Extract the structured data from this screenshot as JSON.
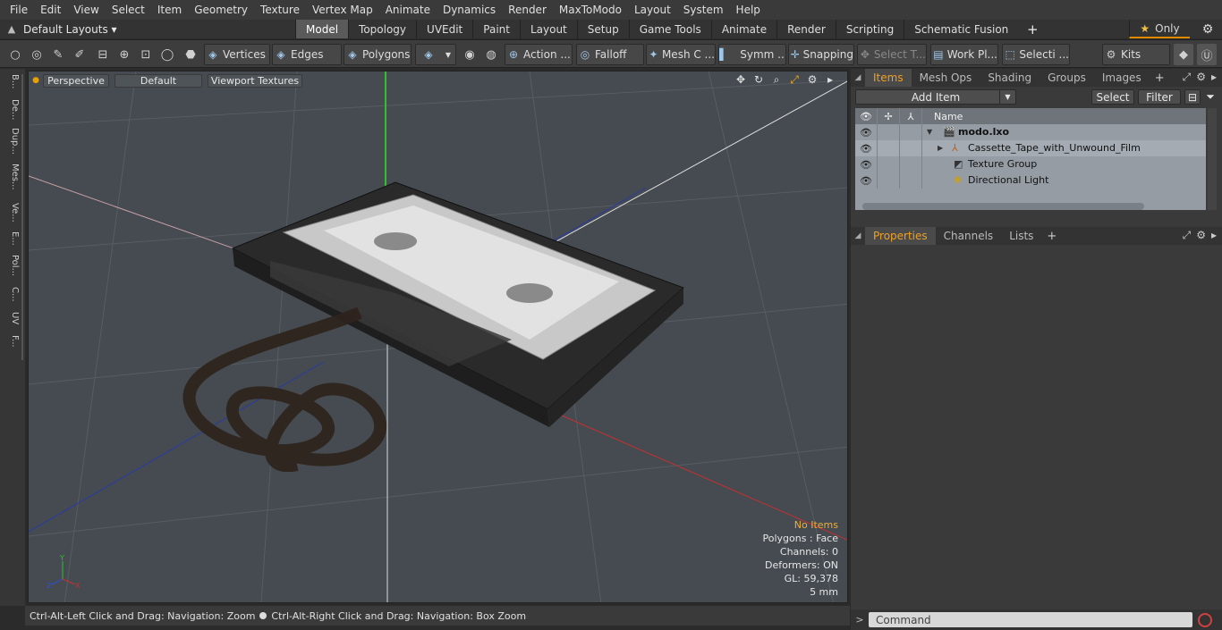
{
  "menubar": {
    "items": [
      "File",
      "Edit",
      "View",
      "Select",
      "Item",
      "Geometry",
      "Texture",
      "Vertex Map",
      "Animate",
      "Dynamics",
      "Render",
      "MaxToModo",
      "Layout",
      "System",
      "Help"
    ]
  },
  "layoutbar": {
    "layouts_label": "Default Layouts ▾",
    "tabs": [
      "Model",
      "Topology",
      "UVEdit",
      "Paint",
      "Layout",
      "Setup",
      "Game Tools",
      "Animate",
      "Render",
      "Scripting",
      "Schematic Fusion"
    ],
    "active_tab": "Model",
    "only_label": "Only"
  },
  "toolbar": {
    "vertices": "Vertices",
    "edges": "Edges",
    "polygons": "Polygons",
    "action": "Action ...",
    "falloff": "Falloff",
    "mesh": "Mesh C ...",
    "symm": "Symm ...",
    "snapping": "Snapping",
    "select_t": "Select T...",
    "work_plane": "Work Pl...",
    "selecti": "Selecti ...",
    "kits": "Kits"
  },
  "left_tabs": [
    "B...",
    "De...",
    "Dup...",
    "Mes...",
    "Ve...",
    "E...",
    "Pol...",
    "C...",
    "UV",
    "F..."
  ],
  "viewport": {
    "view_mode": "Perspective",
    "shading": "Default",
    "textures": "Viewport Textures",
    "stats": {
      "no_items": "No Items",
      "polygons": "Polygons : Face",
      "channels": "Channels: 0",
      "deformers": "Deformers: ON",
      "gl": "GL: 59,378",
      "scale": "5 mm"
    }
  },
  "statusbar": {
    "hint_left": "Ctrl-Alt-Left Click and Drag: Navigation: Zoom",
    "hint_right": "Ctrl-Alt-Right Click and Drag: Navigation: Box Zoom"
  },
  "items_panel": {
    "tabs": [
      "Items",
      "Mesh Ops",
      "Shading",
      "Groups",
      "Images"
    ],
    "active_tab": "Items",
    "add_item": "Add Item",
    "select_btn": "Select",
    "filter_btn": "Filter",
    "name_header": "Name",
    "rows": [
      {
        "label": "modo.lxo"
      },
      {
        "label": "Cassette_Tape_with_Unwound_Film"
      },
      {
        "label": "Texture Group"
      },
      {
        "label": "Directional Light"
      }
    ]
  },
  "properties_panel": {
    "tabs": [
      "Properties",
      "Channels",
      "Lists"
    ],
    "active_tab": "Properties"
  },
  "command": {
    "placeholder": "Command"
  }
}
